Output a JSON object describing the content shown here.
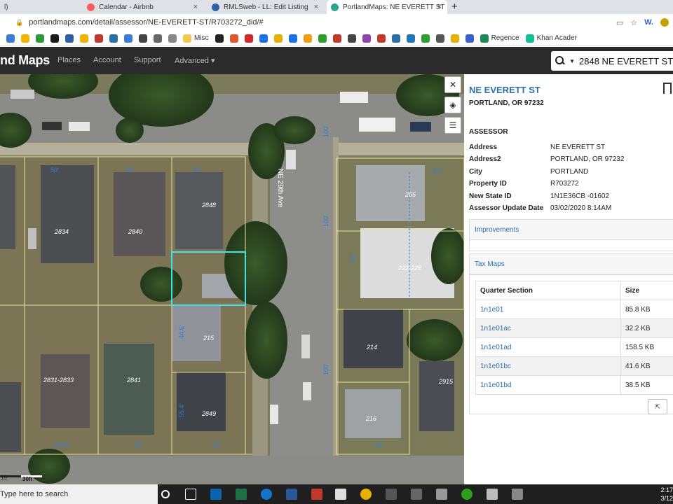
{
  "browser": {
    "tabs": [
      {
        "label": "l)",
        "active": false
      },
      {
        "label": "Calendar - Airbnb",
        "active": false,
        "close": "×"
      },
      {
        "label": "RMLSweb - LL: Edit Listing",
        "active": false,
        "close": "×"
      },
      {
        "label": "PortlandMaps: NE EVERETT ST",
        "active": true,
        "close": "×"
      }
    ],
    "new_tab": "+",
    "url": "portlandmaps.com/detail/assessor/NE-EVERETT-ST/R703272_did/#",
    "bookmarks": [
      {
        "label": "",
        "color": "#3a7bd5"
      },
      {
        "label": "",
        "color": "#f2b400"
      },
      {
        "label": "",
        "color": "#2c9a3b"
      },
      {
        "label": "",
        "color": "#1a1a1a"
      },
      {
        "label": "",
        "color": "#2f5fa8"
      },
      {
        "label": "",
        "color": "#f2b400"
      },
      {
        "label": "",
        "color": "#c0392b"
      },
      {
        "label": "",
        "color": "#2a6fa8"
      },
      {
        "label": "",
        "color": "#3a7bd5"
      },
      {
        "label": "",
        "color": "#444444"
      },
      {
        "label": "",
        "color": "#666666"
      },
      {
        "label": "",
        "color": "#888888"
      },
      {
        "label": "Misc",
        "color": "#f2c94c"
      },
      {
        "label": "",
        "color": "#222222"
      },
      {
        "label": "",
        "color": "#e4572e"
      },
      {
        "label": "",
        "color": "#d62728"
      },
      {
        "label": "",
        "color": "#1a73e8"
      },
      {
        "label": "",
        "color": "#e8b100"
      },
      {
        "label": "",
        "color": "#1a73e8"
      },
      {
        "label": "",
        "color": "#f29c11"
      },
      {
        "label": "",
        "color": "#2ca02c"
      },
      {
        "label": "",
        "color": "#c0392b"
      },
      {
        "label": "",
        "color": "#444444"
      },
      {
        "label": "",
        "color": "#8e44ad"
      },
      {
        "label": "",
        "color": "#c0392b"
      },
      {
        "label": "",
        "color": "#2a6fa8"
      },
      {
        "label": "",
        "color": "#1f77b4"
      },
      {
        "label": "",
        "color": "#2ca02c"
      },
      {
        "label": "",
        "color": "#555555"
      },
      {
        "label": "",
        "color": "#e8b100"
      },
      {
        "label": "",
        "color": "#3a5fcd"
      },
      {
        "label": "Regence",
        "color": "#1a8a5a"
      },
      {
        "label": "Khan Acader",
        "color": "#14bf96"
      }
    ]
  },
  "site": {
    "logo": "nd Maps",
    "nav": [
      "Places",
      "Account",
      "Support",
      "Advanced ▾"
    ],
    "search_value": "2848 NE EVERETT ST"
  },
  "map": {
    "street_label": "NE 29th Ave",
    "house_numbers": [
      "2834",
      "2840",
      "2848",
      "2831-2833",
      "2841",
      "2849",
      "215",
      "214",
      "216",
      "205",
      "222-228",
      "2915"
    ],
    "dimensions": [
      "50'",
      "50'",
      "50'",
      "50'",
      "50'",
      "100'",
      "100'",
      "100'",
      "50'",
      "50'",
      "44.6'",
      "55.4'",
      "50'",
      "50'",
      "50'"
    ],
    "scale": [
      "15",
      "30ft"
    ],
    "controls": [
      "close-map-tool",
      "layers",
      "legend"
    ]
  },
  "panel": {
    "street": "NE EVERETT ST",
    "city": "PORTLAND, OR 97232",
    "section_title": "ASSESSOR",
    "fields": [
      {
        "key": "Address",
        "value": "NE EVERETT ST"
      },
      {
        "key": "Address2",
        "value": "PORTLAND, OR 97232"
      },
      {
        "key": "City",
        "value": "PORTLAND"
      },
      {
        "key": "Property ID",
        "value": "R703272"
      },
      {
        "key": "New State ID",
        "value": "1N1E36CB -01602"
      },
      {
        "key": "Assessor Update Date",
        "value": "03/02/2020 8:14AM"
      }
    ],
    "improvements_label": "Improvements",
    "taxmaps_label": "Tax Maps",
    "taxmaps_headers": [
      "Quarter Section",
      "Size"
    ],
    "taxmaps_rows": [
      {
        "section": "1n1e01",
        "size": "85.8 KB"
      },
      {
        "section": "1n1e01ac",
        "size": "32.2 KB"
      },
      {
        "section": "1n1e01ad",
        "size": "158.5 KB"
      },
      {
        "section": "1n1e01bc",
        "size": "41.6 KB"
      },
      {
        "section": "1n1e01bd",
        "size": "38.5 KB"
      }
    ]
  },
  "taskbar": {
    "search_placeholder": "Type here to search",
    "time": "2:17",
    "date": "3/12"
  }
}
